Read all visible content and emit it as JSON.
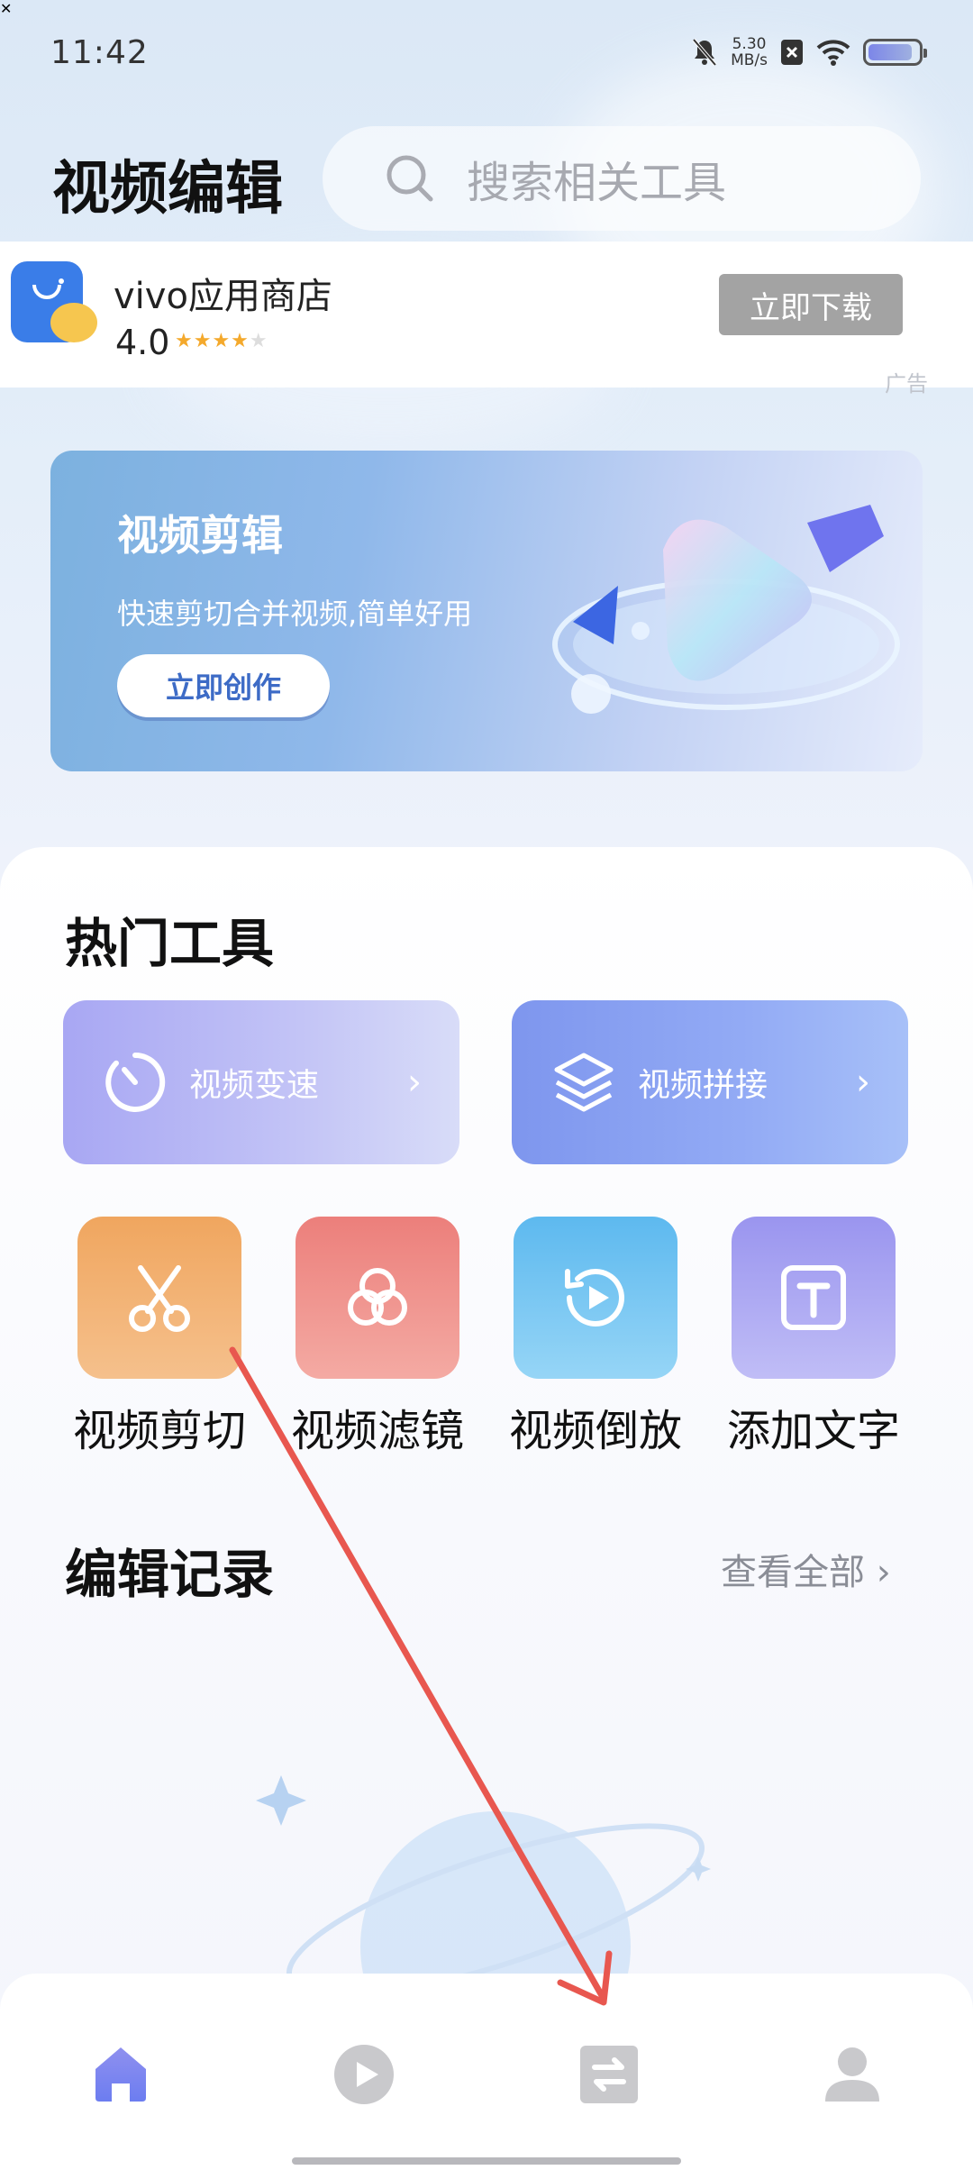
{
  "status_bar": {
    "time": "11:42",
    "net_speed": "5.30",
    "net_unit": "MB/s"
  },
  "header": {
    "title": "视频编辑",
    "search_placeholder": "搜索相关工具"
  },
  "ad": {
    "app_name": "vivo应用商店",
    "rating": "4.0",
    "stars": 4,
    "button": "立即下载",
    "label": "广告"
  },
  "hero": {
    "title": "视频剪辑",
    "subtitle": "快速剪切合并视频,简单好用",
    "cta": "立即创作"
  },
  "hot_tools": {
    "title": "热门工具",
    "large": [
      {
        "label": "视频变速",
        "icon": "speed-gauge-icon"
      },
      {
        "label": "视频拼接",
        "icon": "layers-icon"
      }
    ],
    "small": [
      {
        "label": "视频剪切",
        "icon": "scissors-icon",
        "color": "#f2a863"
      },
      {
        "label": "视频滤镜",
        "icon": "filter-circles-icon",
        "color": "#ef8a86"
      },
      {
        "label": "视频倒放",
        "icon": "reverse-play-icon",
        "color": "#6fc1ef"
      },
      {
        "label": "添加文字",
        "icon": "text-box-icon",
        "color": "#a59ef2"
      }
    ]
  },
  "records": {
    "title": "编辑记录",
    "see_all": "查看全部"
  },
  "bottom_nav": [
    {
      "icon": "home-icon",
      "active": true
    },
    {
      "icon": "play-icon",
      "active": false
    },
    {
      "icon": "transfer-icon",
      "active": false
    },
    {
      "icon": "profile-icon",
      "active": false
    }
  ]
}
